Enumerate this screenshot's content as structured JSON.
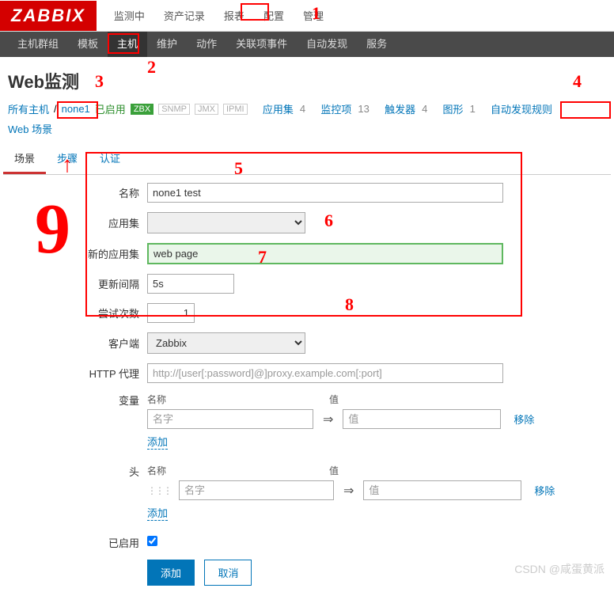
{
  "logo": "ZABBIX",
  "topmenu": [
    "监测中",
    "资产记录",
    "报表",
    "配置",
    "管理"
  ],
  "subnav": [
    "主机群组",
    "模板",
    "主机",
    "维护",
    "动作",
    "关联项事件",
    "自动发现",
    "服务"
  ],
  "page_title": "Web监测",
  "nav3": {
    "all_hosts": "所有主机",
    "host": "none1",
    "enabled": "已启用",
    "zbx": "ZBX",
    "snmp": "SNMP",
    "jmx": "JMX",
    "ipmi": "IPMI",
    "app": "应用集",
    "app_n": "4",
    "mon": "监控项",
    "mon_n": "13",
    "trig": "触发器",
    "trig_n": "4",
    "graph": "图形",
    "graph_n": "1",
    "disc": "自动发现规则",
    "web": "Web 场景"
  },
  "tabs": [
    "场景",
    "步骤",
    "认证"
  ],
  "form": {
    "name_lbl": "名称",
    "name_val": "none1 test",
    "appset_lbl": "应用集",
    "newapp_lbl": "新的应用集",
    "newapp_val": "web page",
    "interval_lbl": "更新间隔",
    "interval_val": "5s",
    "retry_lbl": "尝试次数",
    "retry_val": "1",
    "client_lbl": "客户端",
    "client_val": "Zabbix",
    "proxy_lbl": "HTTP 代理",
    "proxy_ph": "http://[user[:password]@]proxy.example.com[:port]",
    "var_lbl": "变量",
    "head_lbl": "头",
    "col_name": "名称",
    "col_val": "值",
    "ph_name": "名字",
    "ph_val": "值",
    "remove": "移除",
    "add": "添加",
    "enabled_lbl": "已启用",
    "btn_submit": "添加",
    "btn_cancel": "取消"
  },
  "watermark": "CSDN @咸蛋黄派",
  "annot": {
    "a1": "1",
    "a2": "2",
    "a3": "3",
    "a4": "4",
    "a5": "5",
    "a6": "6",
    "a7": "7",
    "a8": "8",
    "a9": "9"
  }
}
